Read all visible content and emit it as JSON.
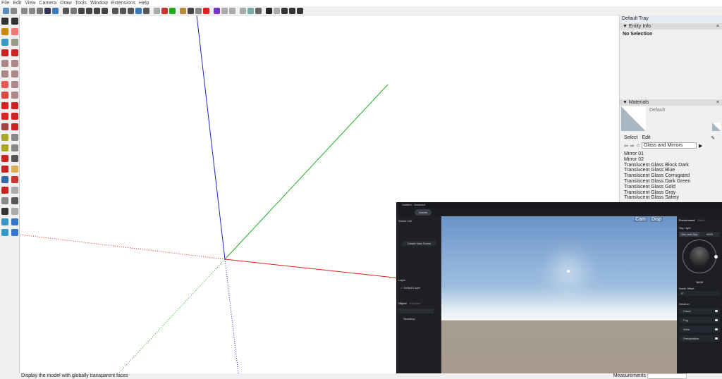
{
  "menu": [
    "File",
    "Edit",
    "View",
    "Camera",
    "Draw",
    "Tools",
    "Window",
    "Extensions",
    "Help"
  ],
  "tray": {
    "title": "Default Tray",
    "entity_info": {
      "title": "Entity Info",
      "status": "No Selection"
    },
    "materials": {
      "title": "Materials",
      "current": "Default",
      "tabs": [
        "Select",
        "Edit"
      ],
      "library": "Glass and Mirrors",
      "items": [
        "Mirror 01",
        "Mirror 02",
        "Translucent Glass Block Dark",
        "Translucent Glass Blue",
        "Translucent Glass Corrugated",
        "Translucent Glass Dark Green",
        "Translucent Glass Gold",
        "Translucent Glass Gray",
        "Translucent Glass Safety"
      ]
    }
  },
  "status": {
    "hint": "Display the model with globally transparent faces",
    "measurements_label": "Measurements"
  },
  "app": {
    "title": "Untitled - Unsaved",
    "assets_label": "Assets",
    "scene_list_label": "Scene List",
    "create_scene_label": "Create New Scene",
    "layer_label": "Layer",
    "default_layer": "Default Layer",
    "object_tabs": [
      "Object",
      "Imported"
    ],
    "object_item": "Sketchup",
    "view_buttons": [
      "Cam",
      "Disp"
    ],
    "right_tabs": [
      "Environment",
      "Effect"
    ],
    "sky_light_label": "Sky Light",
    "sky_modes": [
      "Geo and Sky",
      "HDRI"
    ],
    "time": "18:00",
    "north_offset_label": "North Offset",
    "north_offset_value": "0°",
    "weather_label": "Weather",
    "weather_items": [
      "Cloud",
      "Fog",
      "Wind",
      "Precipitation"
    ]
  },
  "colors": {
    "x_axis": "#e02020",
    "y_axis": "#20b020",
    "z_axis": "#2020d0",
    "app_bg": "#1e2026"
  }
}
